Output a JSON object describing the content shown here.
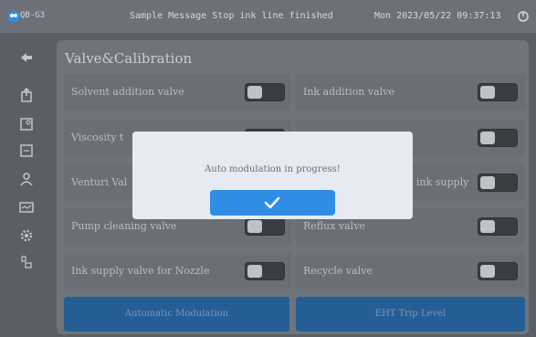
{
  "topbar": {
    "model": "QB-G3",
    "message": "Sample Message Stop ink line finished",
    "datetime": "Mon 2023/05/22 09:37:13"
  },
  "sidebar": {
    "icons": [
      "back-icon",
      "export-icon",
      "settings-doc-icon",
      "edit-doc-icon",
      "user-icon",
      "monitor-icon",
      "gear-icon",
      "filter-icon"
    ]
  },
  "panel": {
    "title": "Valve&Calibration",
    "left_rows": [
      {
        "label": "Solvent addition valve",
        "state": "off"
      },
      {
        "label": "Viscosity t",
        "state": "off"
      },
      {
        "label": "Venturi Val",
        "state": "off"
      },
      {
        "label": "Pump cleaning valve",
        "state": "off"
      },
      {
        "label": "Ink supply valve for Nozzle",
        "state": "off"
      }
    ],
    "right_rows": [
      {
        "label": "Ink addition valve",
        "state": "off"
      },
      {
        "label": "",
        "state": "off"
      },
      {
        "label": "ink supply",
        "state": "off"
      },
      {
        "label": "Reflux valve",
        "state": "off"
      },
      {
        "label": "Recycle valve",
        "state": "off"
      }
    ],
    "buttons": {
      "auto_modulation": "Automatic Modulation",
      "eht_trip": "EHT Trip Level"
    }
  },
  "dialog": {
    "message": "Auto modulation in progress!",
    "confirm_icon": "check-icon"
  },
  "colors": {
    "accent": "#2f8de6",
    "bottom_button": "#255e95"
  }
}
